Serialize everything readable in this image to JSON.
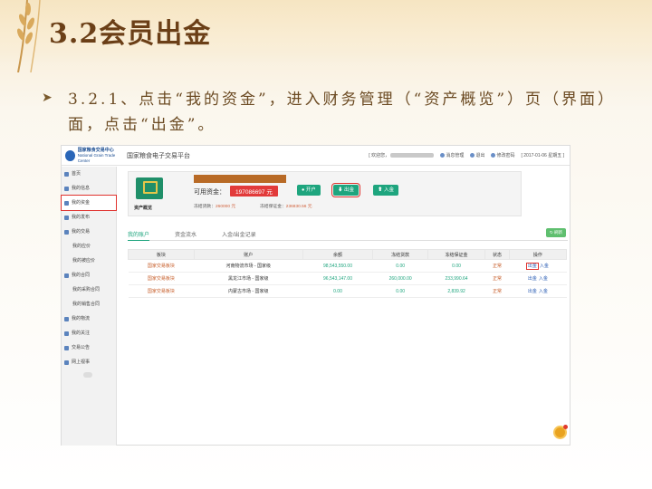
{
  "slide": {
    "title": "3.2会员出金",
    "bullet": "3.2.1、点击“我的资金”，进入财务管理（“资产概览”）页（界面）面，点击“出金”。"
  },
  "app": {
    "logo_name": "国家粮食交易中心",
    "logo_sub": "National Grain Trade Center",
    "platform_title": "国家粮食电子交易平台",
    "welcome": "[ 欢迎您，",
    "message": "消息管理",
    "logout": "退出",
    "change_password": "修改密码",
    "date": "[ 2017-01-06 星期五 ]"
  },
  "sidebar": {
    "items": [
      {
        "label": "首页",
        "sub": false
      },
      {
        "label": "我的信息",
        "sub": false
      },
      {
        "label": "我的资金",
        "sub": false,
        "active": true
      },
      {
        "label": "我的发布",
        "sub": false
      },
      {
        "label": "我的交易",
        "sub": false
      },
      {
        "label": "我的应价",
        "sub": true
      },
      {
        "label": "我的被应价",
        "sub": true
      },
      {
        "label": "我的合同",
        "sub": false
      },
      {
        "label": "我的采购合同",
        "sub": true
      },
      {
        "label": "我的销售合同",
        "sub": true
      },
      {
        "label": "我的物流",
        "sub": false
      },
      {
        "label": "我的关注",
        "sub": false
      },
      {
        "label": "交易公告",
        "sub": false
      },
      {
        "label": "网上视事",
        "sub": false
      }
    ]
  },
  "summary": {
    "label": "资产概览",
    "available_label": "可用资金：",
    "available_value": "197086697 元",
    "open_btn": "开户",
    "withdraw_btn": "出金",
    "deposit_btn": "入金",
    "frozen_goods_label": "冻结货款：",
    "frozen_goods_value": "260000 元",
    "frozen_margin_label": "冻结保证金：",
    "frozen_margin_value": "236830.56 元"
  },
  "tabs": [
    "我的账户",
    "资金流水",
    "入金/出金记录"
  ],
  "refresh": "刷新",
  "table": {
    "headers": [
      "板块",
      "账户",
      "余额",
      "冻结货款",
      "冻结保证金",
      "状态",
      "操作"
    ],
    "rows": [
      [
        "国家交易板块",
        "河南物流市场 - 国家级",
        "98,543,550.00",
        "0.00",
        "0.00",
        "正常"
      ],
      [
        "国家交易板块",
        "黑龙江市场 - 国家级",
        "96,543,147.00",
        "260,000.00",
        "233,990.64",
        "正常"
      ],
      [
        "国家交易板块",
        "内蒙古市场 - 国家级",
        "0.00",
        "0.00",
        "2,839.92",
        "正常"
      ]
    ],
    "op_withdraw": "出金",
    "op_deposit": "入金"
  }
}
